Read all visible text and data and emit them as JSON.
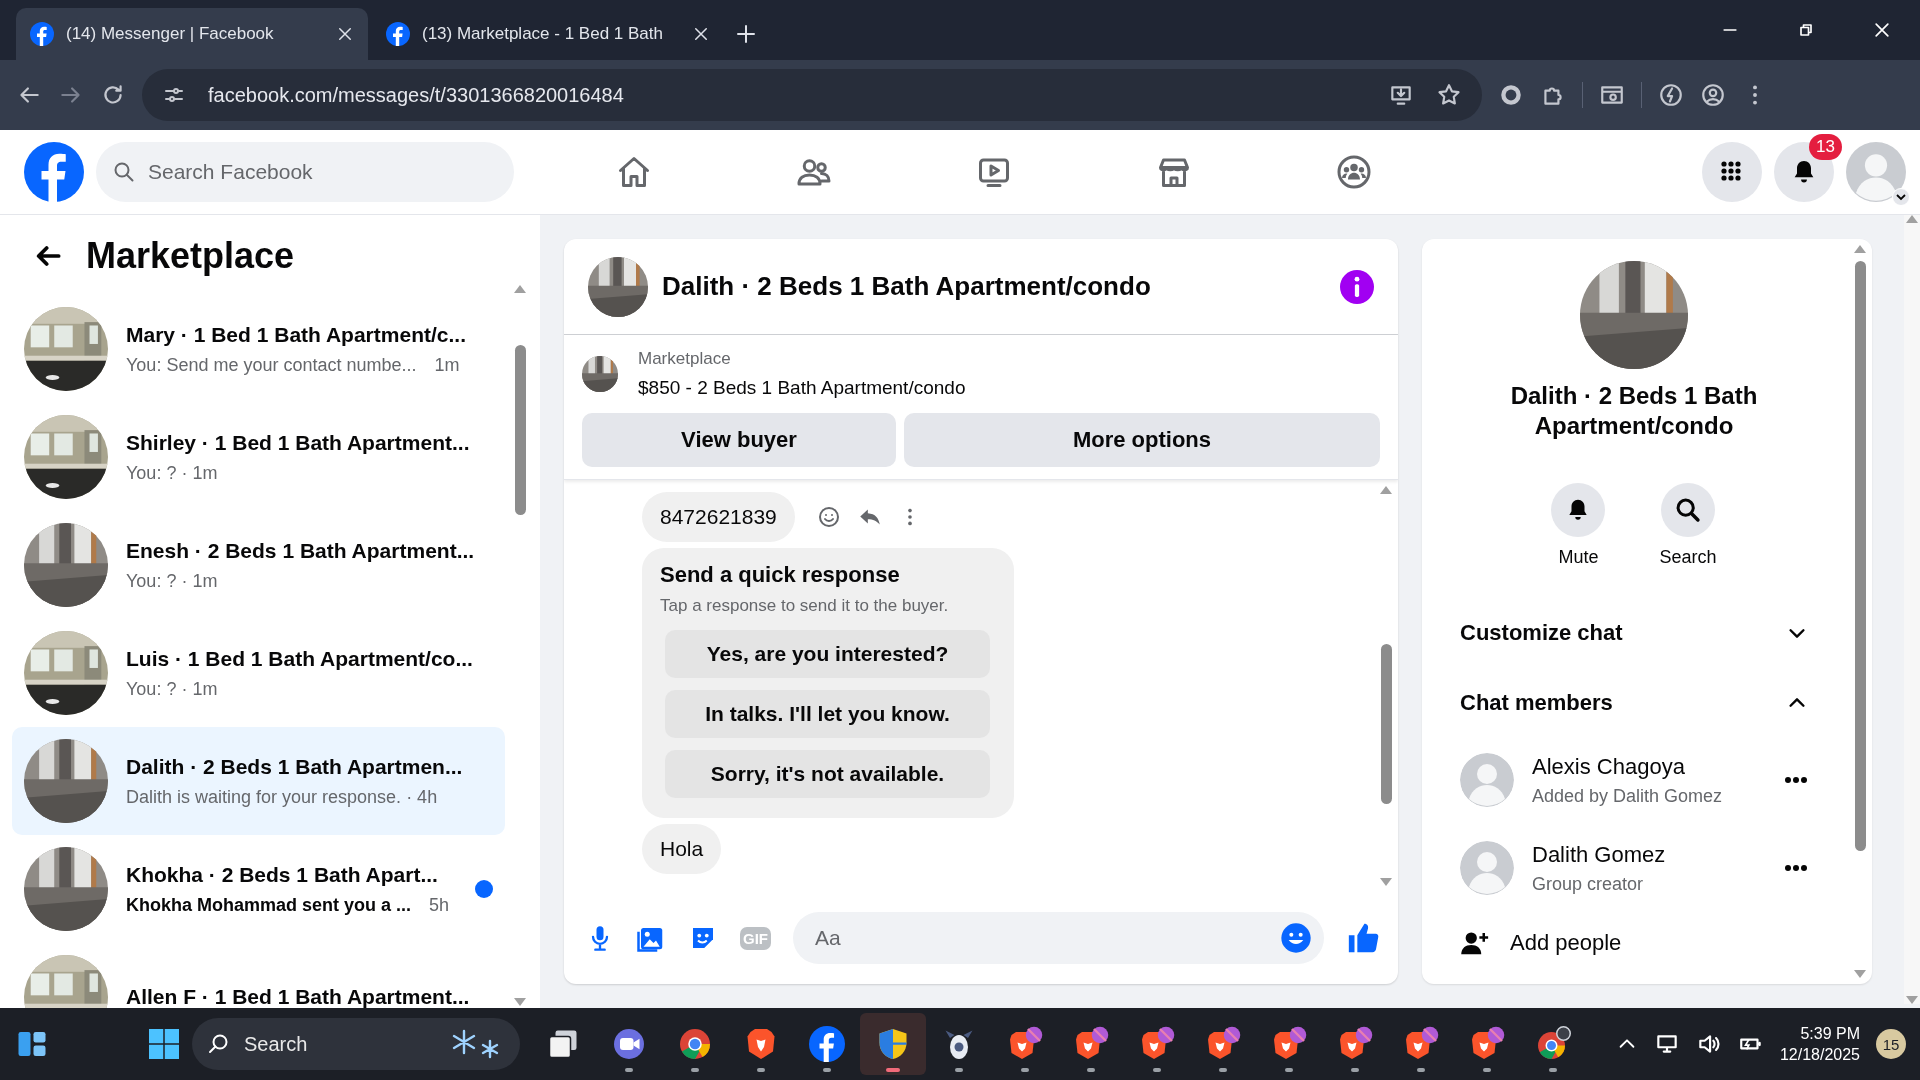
{
  "browser": {
    "tabs": [
      {
        "title": "(14) Messenger | Facebook",
        "selected": true
      },
      {
        "title": "(13) Marketplace - 1 Bed 1 Bath",
        "selected": false
      }
    ],
    "url": "facebook.com/messages/t/3301366820016484"
  },
  "header": {
    "search": {
      "placeholder": "Search Facebook"
    },
    "nav": [
      {
        "kind": "home"
      },
      {
        "kind": "friends"
      },
      {
        "kind": "video"
      },
      {
        "kind": "marketplace"
      },
      {
        "kind": "groups"
      }
    ],
    "notification_count": "13"
  },
  "sidebar": {
    "title": "Marketplace",
    "conversations": [
      {
        "title": "Mary · 1 Bed 1 Bath Apartment/c...",
        "preview": "You: Send me your contact numbe...",
        "time": "1m",
        "selected": false,
        "unread": false
      },
      {
        "title": "Shirley · 1 Bed 1 Bath Apartment...",
        "preview": "You: ? · 1m",
        "selected": false,
        "unread": false
      },
      {
        "title": "Enesh · 2 Beds 1 Bath Apartment...",
        "preview": "You: ? · 1m",
        "selected": false,
        "unread": false
      },
      {
        "title": "Luis · 1 Bed 1 Bath Apartment/co...",
        "preview": "You: ? · 1m",
        "selected": false,
        "unread": false
      },
      {
        "title": "Dalith · 2 Beds 1 Bath Apartmen...",
        "preview": "Dalith is waiting for your response. · 4h",
        "selected": true,
        "unread": false
      },
      {
        "title": "Khokha · 2 Beds 1 Bath Apart...",
        "preview": "Khokha Mohammad sent you a ...",
        "time": "5h",
        "selected": false,
        "unread": true
      },
      {
        "title": "Allen F · 1 Bed 1 Bath Apartment...",
        "selected": false,
        "unread": false
      }
    ]
  },
  "chat": {
    "title": "Dalith · 2 Beds 1 Bath Apartment/condo",
    "listing": {
      "label": "Marketplace",
      "item": "$850 - 2 Beds 1 Bath Apartment/condo"
    },
    "buttons": [
      "View buyer",
      "More options"
    ],
    "messages": [
      {
        "kind": "bubble",
        "text": "8472621839",
        "actions": true
      },
      {
        "kind": "quick_response",
        "title": "Send a quick response",
        "subtitle": "Tap a response to send it to the buyer.",
        "options": [
          "Yes, are you interested?",
          "In talks. I'll let you know.",
          "Sorry, it's not available."
        ]
      },
      {
        "kind": "bubble",
        "text": "Hola",
        "actions": false
      }
    ],
    "composer": {
      "gif_label": "GIF",
      "placeholder": "Aa"
    }
  },
  "info_panel": {
    "title": "Dalith · 2 Beds 1 Bath Apartment/condo",
    "actions": [
      {
        "kind": "mute",
        "label": "Mute"
      },
      {
        "kind": "search",
        "label": "Search"
      }
    ],
    "sections": [
      {
        "title": "Customize chat",
        "expanded": false
      },
      {
        "title": "Chat members",
        "expanded": true,
        "members": [
          {
            "name": "Alexis Chagoya",
            "role": "Added by Dalith Gomez"
          },
          {
            "name": "Dalith Gomez",
            "role": "Group creator"
          }
        ],
        "add_label": "Add people"
      }
    ]
  },
  "taskbar": {
    "search": {
      "placeholder": "Search"
    },
    "apps": [
      {
        "kind": "taskview",
        "selected": false
      },
      {
        "kind": "meet",
        "selected": false
      },
      {
        "kind": "chrome",
        "selected": false
      },
      {
        "kind": "brave",
        "selected": false
      },
      {
        "kind": "facebook",
        "selected": false
      },
      {
        "kind": "security",
        "selected": true
      },
      {
        "kind": "game",
        "selected": false
      },
      {
        "kind": "brave-profile",
        "selected": false
      },
      {
        "kind": "brave-profile",
        "selected": false
      },
      {
        "kind": "brave-profile",
        "selected": false
      },
      {
        "kind": "brave-profile",
        "selected": false
      },
      {
        "kind": "brave-profile",
        "selected": false
      },
      {
        "kind": "brave-profile",
        "selected": false
      },
      {
        "kind": "brave-profile",
        "selected": false
      },
      {
        "kind": "brave-profile",
        "selected": false
      },
      {
        "kind": "chrome-profile",
        "selected": false
      }
    ],
    "time": "5:39 PM",
    "date": "12/18/2025",
    "notification_count": "15"
  }
}
